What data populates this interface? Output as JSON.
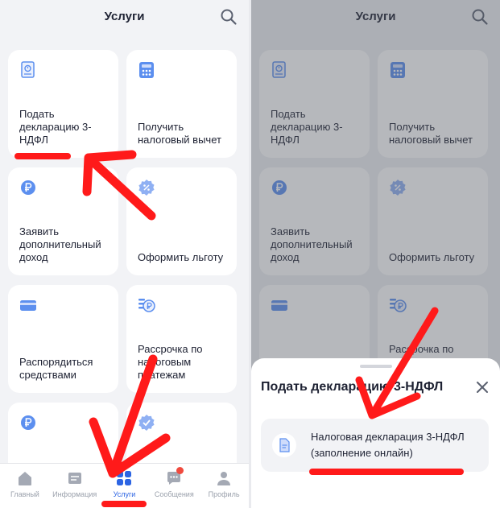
{
  "header": {
    "title": "Услуги"
  },
  "tiles": [
    {
      "label": "Подать декларацию 3-НДФЛ",
      "icon": "document-icon"
    },
    {
      "label": "Получить налоговый вычет",
      "icon": "calculator-icon"
    },
    {
      "label": "Заявить дополнительный доход",
      "icon": "ruble-coin-icon"
    },
    {
      "label": "Оформить льготу",
      "icon": "percent-badge-icon"
    },
    {
      "label": "Распорядиться средствами",
      "icon": "card-icon"
    },
    {
      "label": "Рассрочка по налоговым платежам",
      "icon": "ruble-stack-icon"
    },
    {
      "label": "",
      "icon": "ruble-coin-icon"
    },
    {
      "label": "",
      "icon": "check-badge-icon"
    }
  ],
  "bottom_nav": [
    {
      "label": "Главный",
      "icon": "home-icon",
      "active": false
    },
    {
      "label": "Информация",
      "icon": "info-icon",
      "active": false
    },
    {
      "label": "Услуги",
      "icon": "services-grid-icon",
      "active": true
    },
    {
      "label": "Сообщения",
      "icon": "messages-icon",
      "active": false,
      "badge": true
    },
    {
      "label": "Профиль",
      "icon": "profile-icon",
      "active": false
    }
  ],
  "sheet": {
    "title": "Подать декларацию 3-НДФЛ",
    "option": "Налоговая декларация 3-НДФЛ (заполнение онлайн)",
    "option_icon": "document-icon"
  },
  "colors": {
    "accent": "#2c64e3",
    "icon_blue": "#5c8fef",
    "annotation_red": "#ff1a1a",
    "badge_red": "#f04a3e"
  }
}
